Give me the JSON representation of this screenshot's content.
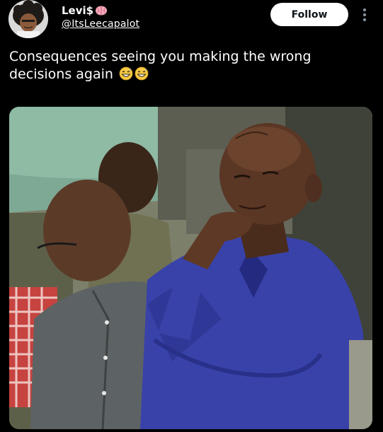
{
  "author": {
    "display_name": "Levi$",
    "handle": "@ItsLeecapalot",
    "badge_icon": "brain-icon"
  },
  "actions": {
    "follow_label": "Follow",
    "more_icon": "more-vertical-icon"
  },
  "tweet": {
    "text": "Consequences seeing you making the wrong decisions again",
    "emoji_icons": [
      "grinning-sweat-emoji",
      "grinning-sweat-emoji"
    ]
  },
  "colors": {
    "background": "#000000",
    "text": "#ffffff",
    "follow_button_bg": "#ffffff",
    "follow_button_text": "#0f1419"
  }
}
